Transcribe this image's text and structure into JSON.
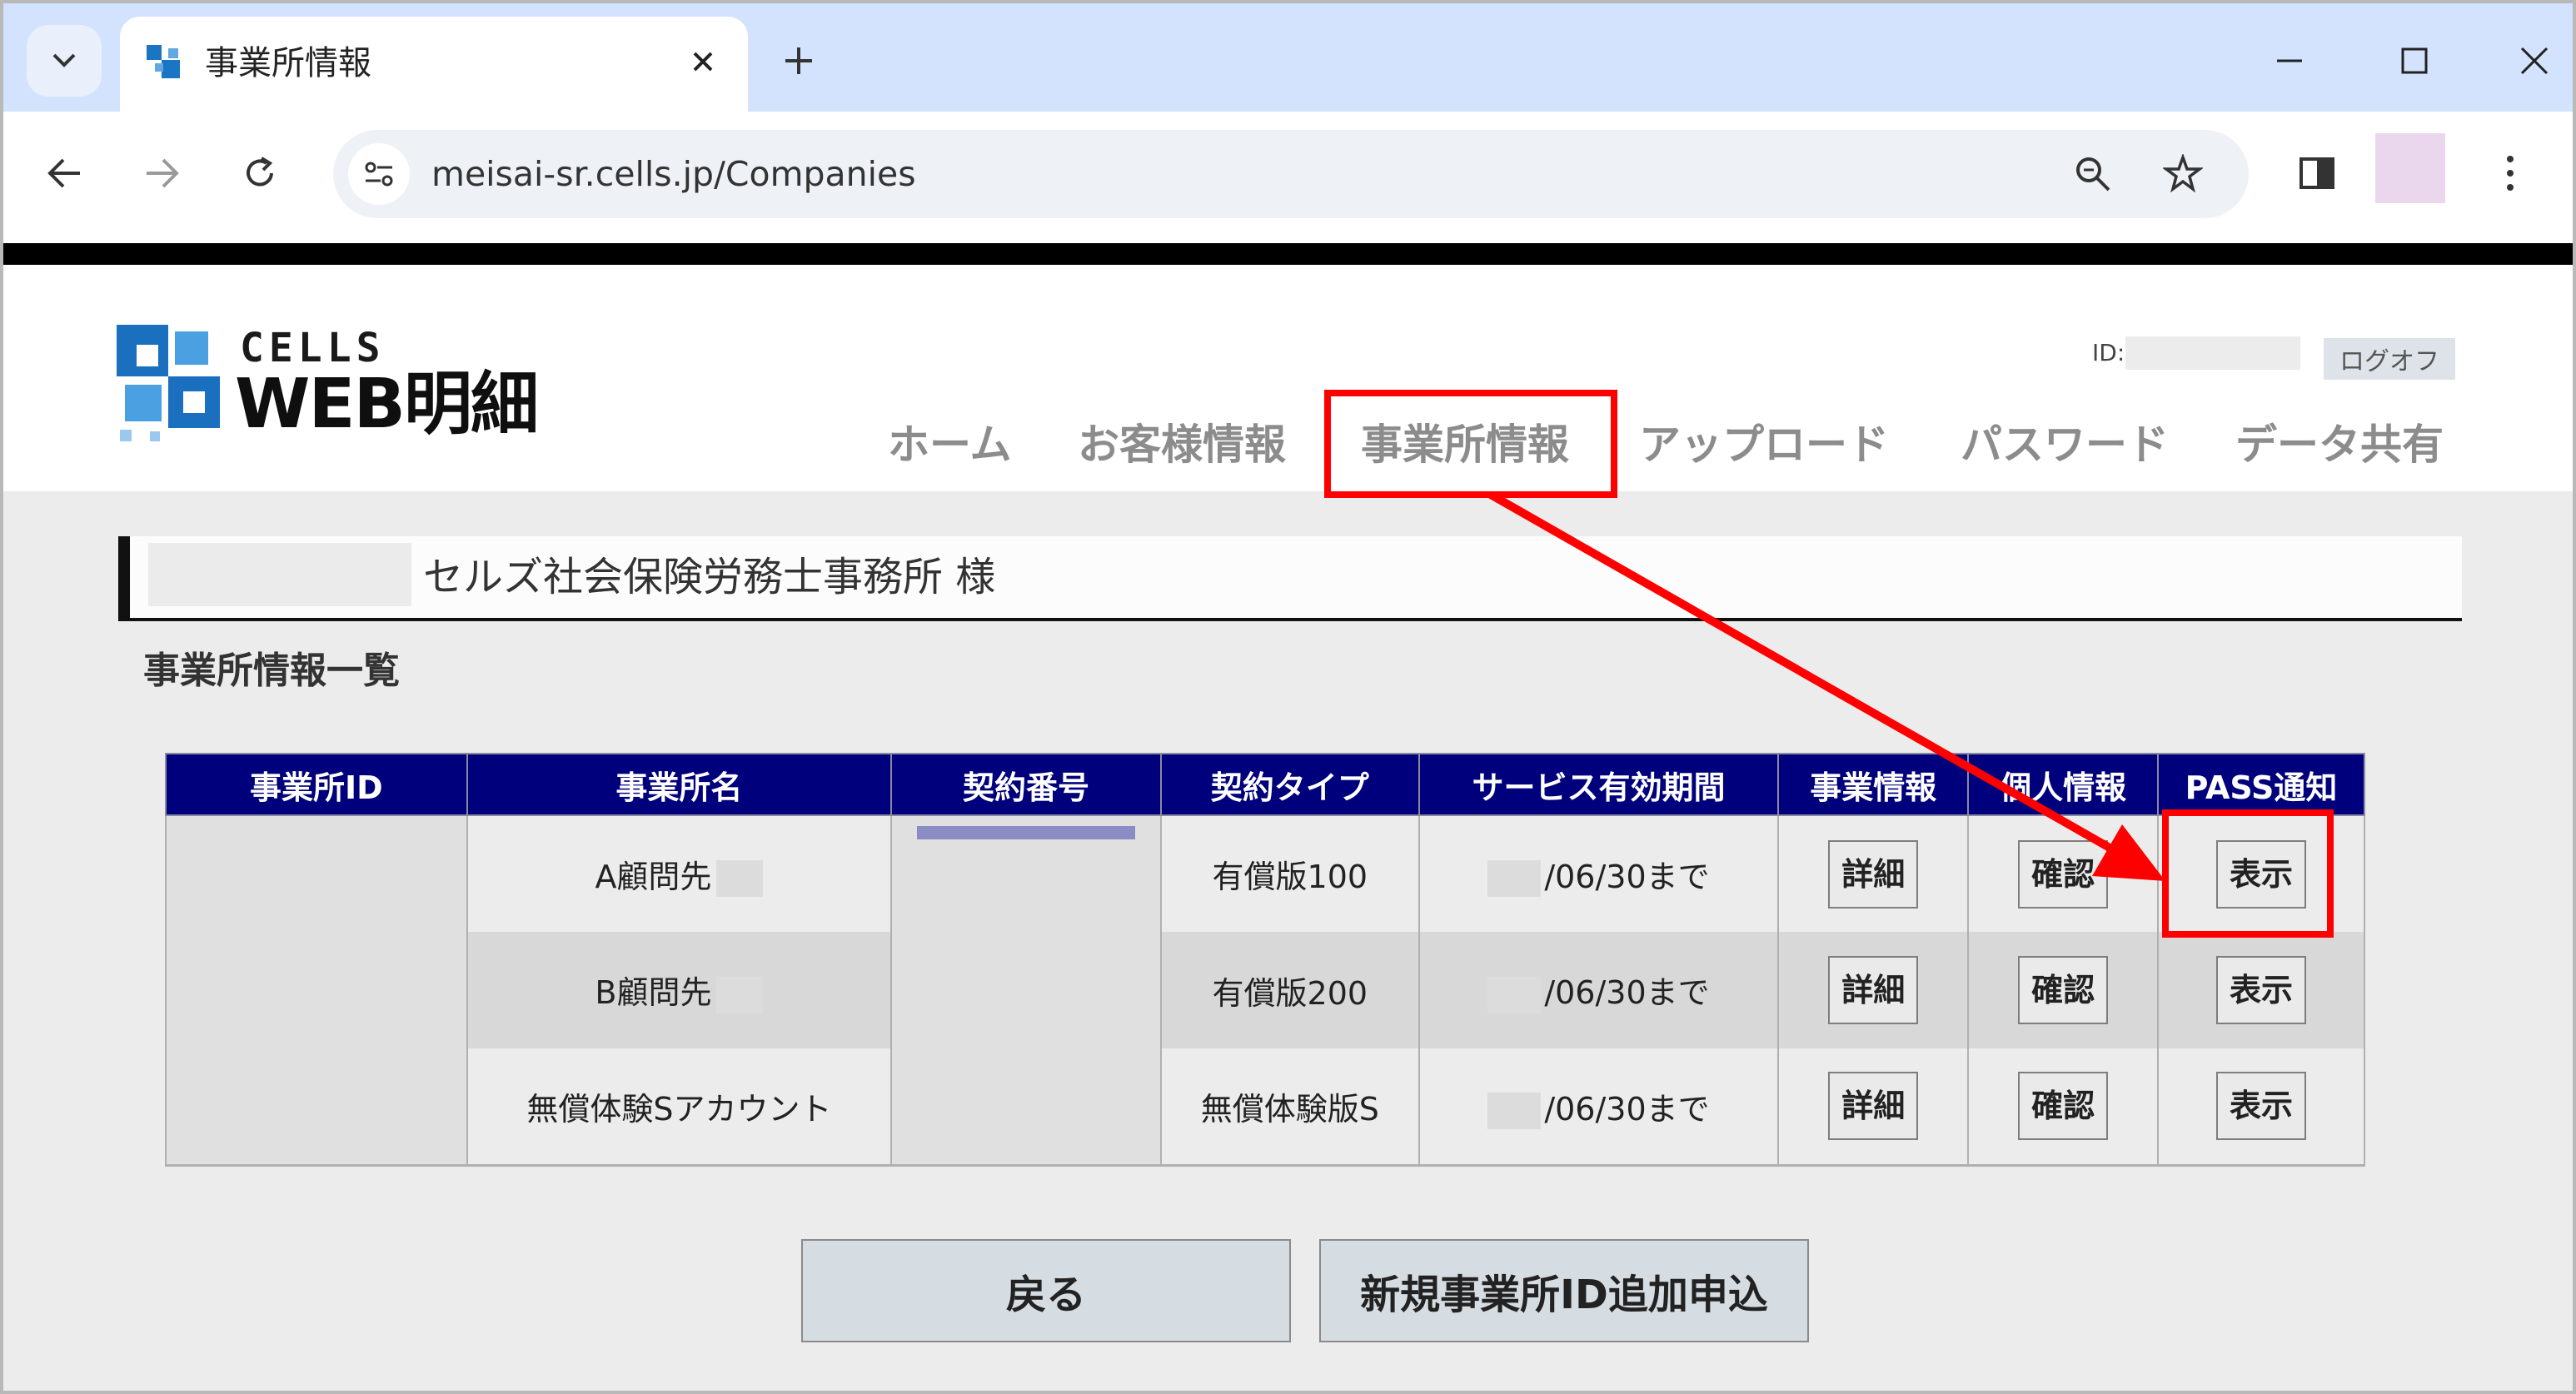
{
  "browser": {
    "tab_title": "事業所情報",
    "url": "meisai-sr.cells.jp/Companies"
  },
  "site": {
    "logo_cells": "CELLS",
    "logo_web": "WEB明細",
    "id_label": "ID:",
    "logoff_label": "ログオフ",
    "nav": [
      "ホーム",
      "お客様情報",
      "事業所情報",
      "アップロード",
      "パスワード",
      "データ共有"
    ],
    "active_nav": "事業所情報"
  },
  "customer": {
    "name": "セルズ社会保険労務士事務所 様"
  },
  "list": {
    "title": "事業所情報一覧",
    "columns": [
      "事業所ID",
      "事業所名",
      "契約番号",
      "契約タイプ",
      "サービス有効期間",
      "事業情報",
      "個人情報",
      "PASS通知"
    ],
    "rows": [
      {
        "name": "A顧問先",
        "type": "有償版100",
        "period": "/06/30まで",
        "detail": "詳細",
        "confirm": "確認",
        "show": "表示"
      },
      {
        "name": "B顧問先",
        "type": "有償版200",
        "period": "/06/30まで",
        "detail": "詳細",
        "confirm": "確認",
        "show": "表示"
      },
      {
        "name": "無償体験Sアカウント",
        "type": "無償体験版S",
        "period": "/06/30まで",
        "detail": "詳細",
        "confirm": "確認",
        "show": "表示"
      }
    ]
  },
  "buttons": {
    "back": "戻る",
    "add": "新規事業所ID追加申込"
  },
  "colors": {
    "tabstrip": "#d3e3fd",
    "header_navy": "#00007c",
    "annotation_red": "#ff0000",
    "content_bg": "#ececec"
  },
  "icons": [
    "tab-search-icon",
    "favicon-icon",
    "close-icon",
    "plus-icon",
    "minimize-icon",
    "maximize-icon",
    "window-close-icon",
    "back-arrow-icon",
    "forward-arrow-icon",
    "reload-icon",
    "site-info-icon",
    "zoom-icon",
    "star-icon",
    "side-panel-icon",
    "kebab-menu-icon"
  ]
}
